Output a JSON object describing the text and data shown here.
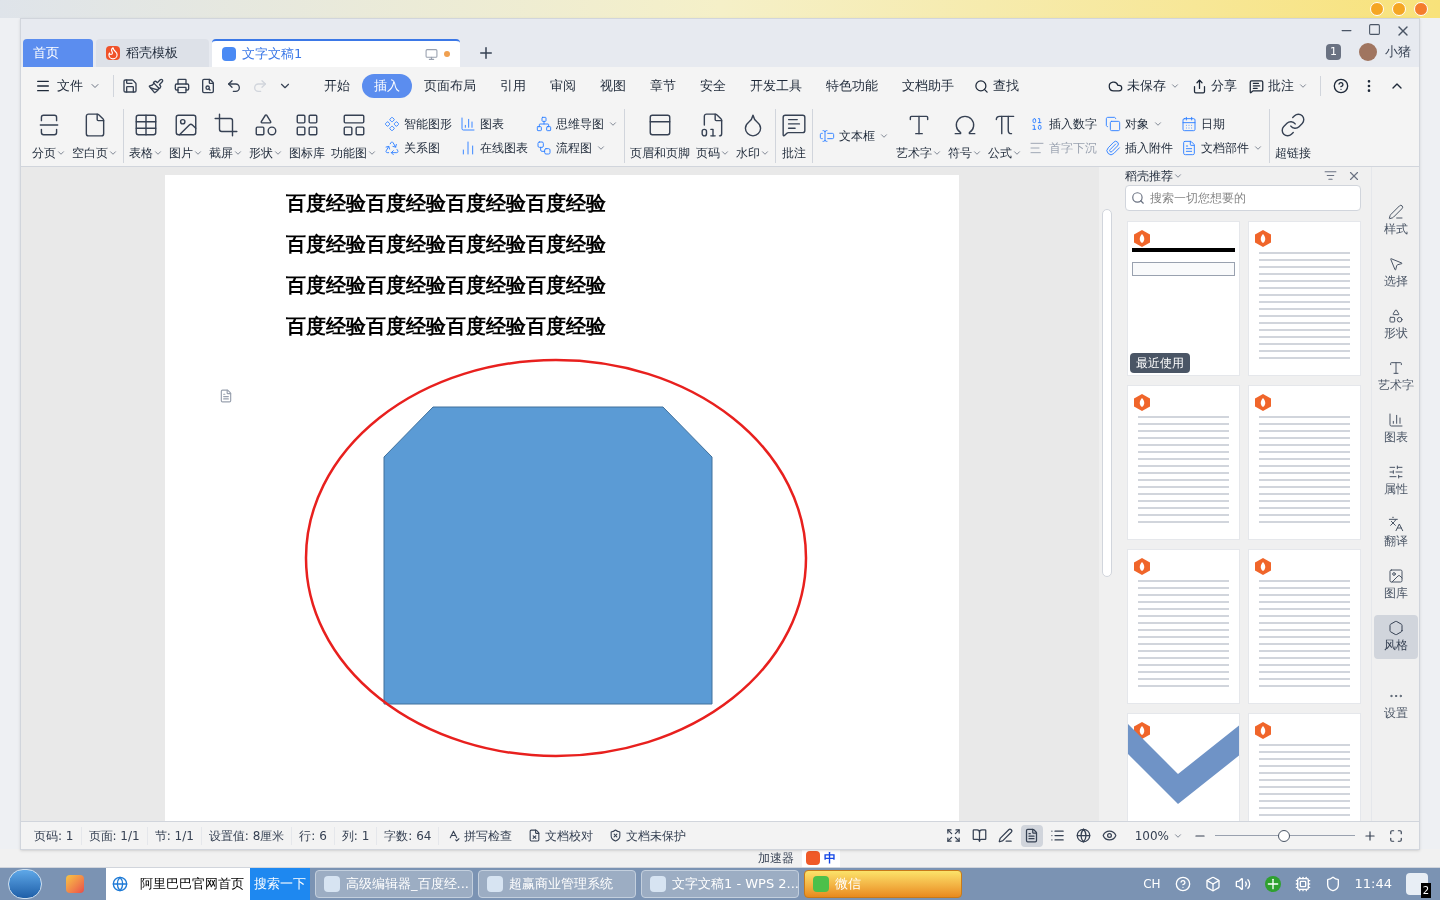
{
  "window_tabs": [
    {
      "label": "首页",
      "kind": "home",
      "selected": false
    },
    {
      "label": "稻壳模板",
      "kind": "docer",
      "selected": false
    },
    {
      "label": "文字文稿1",
      "kind": "doc",
      "selected": true
    }
  ],
  "account": {
    "badge": "1",
    "name": "小猪"
  },
  "file_menu": "文件",
  "redo": {
    "disabled": true
  },
  "ribbon_tabs": [
    {
      "label": "开始",
      "selected": false
    },
    {
      "label": "插入",
      "selected": true
    },
    {
      "label": "页面布局",
      "selected": false
    },
    {
      "label": "引用",
      "selected": false
    },
    {
      "label": "审阅",
      "selected": false
    },
    {
      "label": "视图",
      "selected": false
    },
    {
      "label": "章节",
      "selected": false
    },
    {
      "label": "安全",
      "selected": false
    },
    {
      "label": "开发工具",
      "selected": false
    },
    {
      "label": "特色功能",
      "selected": false
    },
    {
      "label": "文档助手",
      "selected": false
    }
  ],
  "search_label": "查找",
  "right_actions": [
    {
      "label": "未保存",
      "dropdown": true
    },
    {
      "label": "分享",
      "dropdown": false
    },
    {
      "label": "批注",
      "dropdown": true
    }
  ],
  "ribbon_groups": [
    {
      "items": [
        {
          "kind": "large",
          "label": "分页",
          "dropdown": true
        },
        {
          "kind": "large",
          "label": "空白页",
          "dropdown": true
        }
      ]
    },
    {
      "items": [
        {
          "kind": "large",
          "label": "表格",
          "dropdown": true
        },
        {
          "kind": "large",
          "label": "图片",
          "dropdown": true
        },
        {
          "kind": "large",
          "label": "截屏",
          "dropdown": true
        },
        {
          "kind": "large",
          "label": "形状",
          "dropdown": true
        },
        {
          "kind": "large",
          "label": "图标库",
          "dropdown": false
        },
        {
          "kind": "large",
          "label": "功能图",
          "dropdown": true
        },
        {
          "kind": "stack",
          "entries": [
            {
              "label": "智能图形",
              "dropdown": false,
              "disabled": false
            },
            {
              "label": "关系图",
              "dropdown": false,
              "disabled": false
            }
          ]
        },
        {
          "kind": "stack",
          "entries": [
            {
              "label": "图表",
              "dropdown": false,
              "disabled": false
            },
            {
              "label": "在线图表",
              "dropdown": false,
              "disabled": false
            }
          ]
        },
        {
          "kind": "stack",
          "entries": [
            {
              "label": "思维导图",
              "dropdown": true,
              "disabled": false
            },
            {
              "label": "流程图",
              "dropdown": true,
              "disabled": false
            }
          ]
        }
      ]
    },
    {
      "items": [
        {
          "kind": "large",
          "label": "页眉和页脚",
          "dropdown": false
        },
        {
          "kind": "large",
          "label": "页码",
          "dropdown": true
        },
        {
          "kind": "large",
          "label": "水印",
          "dropdown": true
        }
      ]
    },
    {
      "items": [
        {
          "kind": "large",
          "label": "批注",
          "dropdown": false
        }
      ]
    },
    {
      "items": [
        {
          "kind": "stack",
          "entries": [
            {
              "label": "文本框",
              "dropdown": true,
              "disabled": false
            }
          ]
        },
        {
          "kind": "large",
          "label": "艺术字",
          "dropdown": true
        },
        {
          "kind": "large",
          "label": "符号",
          "dropdown": true
        },
        {
          "kind": "large",
          "label": "公式",
          "dropdown": true
        },
        {
          "kind": "stack",
          "entries": [
            {
              "label": "插入数字",
              "dropdown": false,
              "disabled": false
            },
            {
              "label": "首字下沉",
              "dropdown": false,
              "disabled": true
            }
          ]
        },
        {
          "kind": "stack",
          "entries": [
            {
              "label": "对象",
              "dropdown": true,
              "disabled": false
            },
            {
              "label": "插入附件",
              "dropdown": false,
              "disabled": false
            }
          ]
        },
        {
          "kind": "stack",
          "entries": [
            {
              "label": "日期",
              "dropdown": false,
              "disabled": false
            },
            {
              "label": "文档部件",
              "dropdown": true,
              "disabled": false
            }
          ]
        }
      ]
    },
    {
      "items": [
        {
          "kind": "large",
          "label": "超链接",
          "dropdown": false
        }
      ]
    }
  ],
  "document": {
    "lines": [
      "百度经验百度经验百度经验百度经验",
      "百度经验百度经验百度经验百度经验",
      "百度经验百度经验百度经验百度经验",
      "百度经验百度经验百度经验百度经验"
    ]
  },
  "panel": {
    "title": "稻壳推荐",
    "search": {
      "placeholder": "搜索一切您想要的"
    },
    "templates": [
      {
        "kind": "sign",
        "badge": "最近使用"
      },
      {
        "kind": "article"
      },
      {
        "kind": "article"
      },
      {
        "kind": "article"
      },
      {
        "kind": "article"
      },
      {
        "kind": "article"
      },
      {
        "kind": "cover"
      },
      {
        "kind": "article"
      }
    ]
  },
  "side_tools": [
    {
      "label": "样式",
      "selected": false
    },
    {
      "label": "选择",
      "selected": false
    },
    {
      "label": "形状",
      "selected": false
    },
    {
      "label": "艺术字",
      "selected": false
    },
    {
      "label": "图表",
      "selected": false
    },
    {
      "label": "属性",
      "selected": false
    },
    {
      "label": "翻译",
      "selected": false
    },
    {
      "label": "图库",
      "selected": false
    },
    {
      "label": "风格",
      "selected": true
    },
    {
      "label": "设置",
      "selected": false
    }
  ],
  "status_items": [
    "页码: 1",
    "页面: 1/1",
    "节: 1/1",
    "设置值: 8厘米",
    "行: 6",
    "列: 1",
    "字数: 64"
  ],
  "status_tools": [
    "拼写检查",
    "文档校对",
    "文档未保护"
  ],
  "view_modes": [
    {
      "selected": false
    },
    {
      "selected": false
    },
    {
      "selected": false
    },
    {
      "selected": true
    },
    {
      "selected": false
    },
    {
      "selected": false
    },
    {
      "selected": false
    }
  ],
  "zoom": {
    "reading": "100%",
    "level": 0.49
  },
  "system_strip": {
    "accelerator": "加速器",
    "ime": "中"
  },
  "taskbar": {
    "address": "阿里巴巴官网首页",
    "search_button": "搜索一下",
    "items": [
      {
        "label": "高级编辑器_百度经...",
        "highlighted": false
      },
      {
        "label": "超赢商业管理系统",
        "highlighted": false
      },
      {
        "label": "文字文稿1 - WPS 2...",
        "highlighted": false
      },
      {
        "label": "微信",
        "highlighted": true
      }
    ],
    "lang": "CH",
    "time": "11:44",
    "notifications": "2"
  }
}
